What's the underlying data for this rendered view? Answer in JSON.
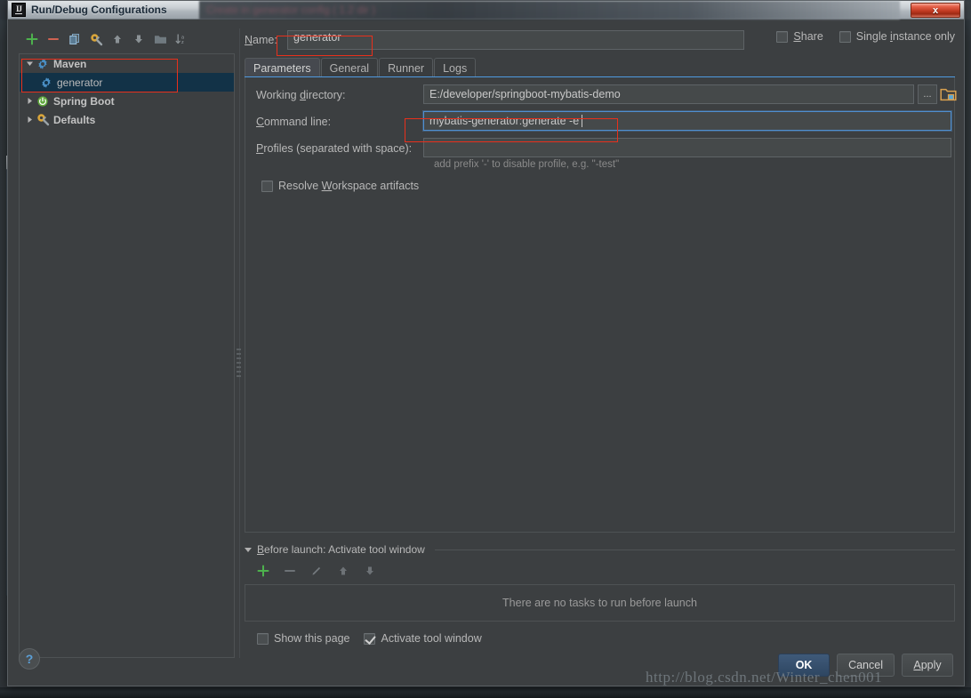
{
  "window": {
    "title": "Run/Debug Configurations",
    "app_icon": "intellij-idea-icon",
    "close_label": "x",
    "backdrop_ghost": "Create in generator config ( 1.2 dir )"
  },
  "sidebar": {
    "toolbar": [
      {
        "name": "add-configuration-button",
        "icon": "plus-icon",
        "title": "Add New Configuration"
      },
      {
        "name": "remove-configuration-button",
        "icon": "minus-icon",
        "title": "Remove Configuration"
      },
      {
        "name": "copy-configuration-button",
        "icon": "copy-icon",
        "title": "Copy Configuration"
      },
      {
        "name": "edit-defaults-button",
        "icon": "wrench-gear-icon",
        "title": "Edit defaults"
      },
      {
        "name": "move-up-button",
        "icon": "arrow-up-icon",
        "title": "Move Up"
      },
      {
        "name": "move-down-button",
        "icon": "arrow-down-icon",
        "title": "Move Down"
      },
      {
        "name": "create-folder-button",
        "icon": "folder-icon",
        "title": "Create New Folder"
      },
      {
        "name": "sort-button",
        "icon": "sort-az-icon",
        "title": "Sort Configurations"
      }
    ],
    "tree": [
      {
        "label": "Maven",
        "icon": "maven-gear-icon",
        "level": 0,
        "expanded": true,
        "bold": true,
        "selected": false
      },
      {
        "label": "generator",
        "icon": "maven-gear-icon",
        "level": 1,
        "expanded": false,
        "bold": false,
        "selected": true
      },
      {
        "label": "Spring Boot",
        "icon": "spring-boot-icon",
        "level": 0,
        "expanded": false,
        "bold": true,
        "selected": false
      },
      {
        "label": "Defaults",
        "icon": "wrench-gear-icon",
        "level": 0,
        "expanded": false,
        "bold": true,
        "selected": false
      }
    ]
  },
  "form": {
    "name_label": "Name:",
    "name_value": "generator",
    "share": {
      "label": "Share",
      "checked": false
    },
    "single_instance": {
      "label": "Single instance only",
      "checked": false
    },
    "tabs": [
      {
        "label": "Parameters",
        "active": true
      },
      {
        "label": "General",
        "active": false
      },
      {
        "label": "Runner",
        "active": false
      },
      {
        "label": "Logs",
        "active": false
      }
    ],
    "working_directory": {
      "label": "Working directory:",
      "value": "E:/developer/springboot-mybatis-demo",
      "ellipsis_label": "...",
      "browse_icon": "folder-open-icon"
    },
    "command_line": {
      "label": "Command line:",
      "value": "mybatis-generator:generate -e",
      "focused": true
    },
    "profiles": {
      "label": "Profiles (separated with space):",
      "value": "",
      "hint": "add prefix '-' to disable profile, e.g. \"-test\""
    },
    "resolve_workspace": {
      "label": "Resolve Workspace artifacts",
      "checked": false
    }
  },
  "before_launch": {
    "title": "Before launch: Activate tool window",
    "toolbar": [
      {
        "name": "add-task-button",
        "icon": "plus-icon",
        "enabled": true
      },
      {
        "name": "remove-task-button",
        "icon": "minus-icon",
        "enabled": false
      },
      {
        "name": "edit-task-button",
        "icon": "pencil-icon",
        "enabled": false
      },
      {
        "name": "task-move-up-button",
        "icon": "arrow-up-icon",
        "enabled": false
      },
      {
        "name": "task-move-down-button",
        "icon": "arrow-down-icon",
        "enabled": false
      }
    ],
    "empty_text": "There are no tasks to run before launch",
    "show_this_page": {
      "label": "Show this page",
      "checked": false
    },
    "activate_tool_window": {
      "label": "Activate tool window",
      "checked": true
    }
  },
  "footer": {
    "help_label": "?",
    "ok_label": "OK",
    "cancel_label": "Cancel",
    "apply_label": "Apply"
  },
  "watermark": "http://blog.csdn.net/Winter_chen001",
  "colors": {
    "dialog_bg": "#3c3f41",
    "field_bg": "#45494a",
    "accent_blue": "#4f9ae0",
    "selection_blue": "#123247",
    "annotation_red": "#e8301c",
    "plus_green": "#45b545",
    "minus_red": "#d05a48"
  }
}
